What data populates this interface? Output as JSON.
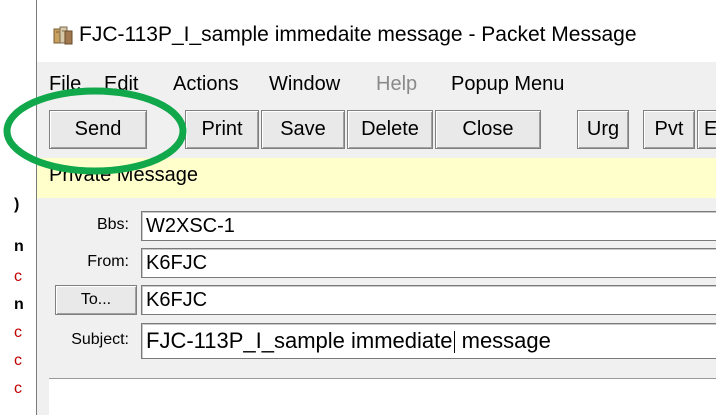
{
  "window": {
    "title": "FJC-113P_I_sample immedaite message - Packet Message"
  },
  "menu": {
    "items": [
      {
        "label": "File",
        "disabled": false
      },
      {
        "label": "Edit",
        "disabled": false
      },
      {
        "label": "Actions",
        "disabled": false
      },
      {
        "label": "Window",
        "disabled": false
      },
      {
        "label": "Help",
        "disabled": true
      },
      {
        "label": "Popup Menu",
        "disabled": false
      }
    ]
  },
  "toolbar": {
    "send_label": "Send",
    "print_label": "Print",
    "save_label": "Save",
    "delete_label": "Delete",
    "close_label": "Close",
    "urg_label": "Urg",
    "pvt_label": "Pvt",
    "more_label": "E"
  },
  "banner": {
    "text": "Private Message",
    "color": "#ffffcc"
  },
  "fields": {
    "bbs": {
      "label": "Bbs:",
      "value": "W2XSC-1"
    },
    "from": {
      "label": "From:",
      "value": "K6FJC"
    },
    "to": {
      "button_label": "To...",
      "value": "K6FJC"
    },
    "subject": {
      "label": "Subject:",
      "value_before_caret": "FJC-113P_I_sample immediate",
      "value_after_caret": " message"
    }
  },
  "annotation": {
    "color": "#10a84a"
  }
}
